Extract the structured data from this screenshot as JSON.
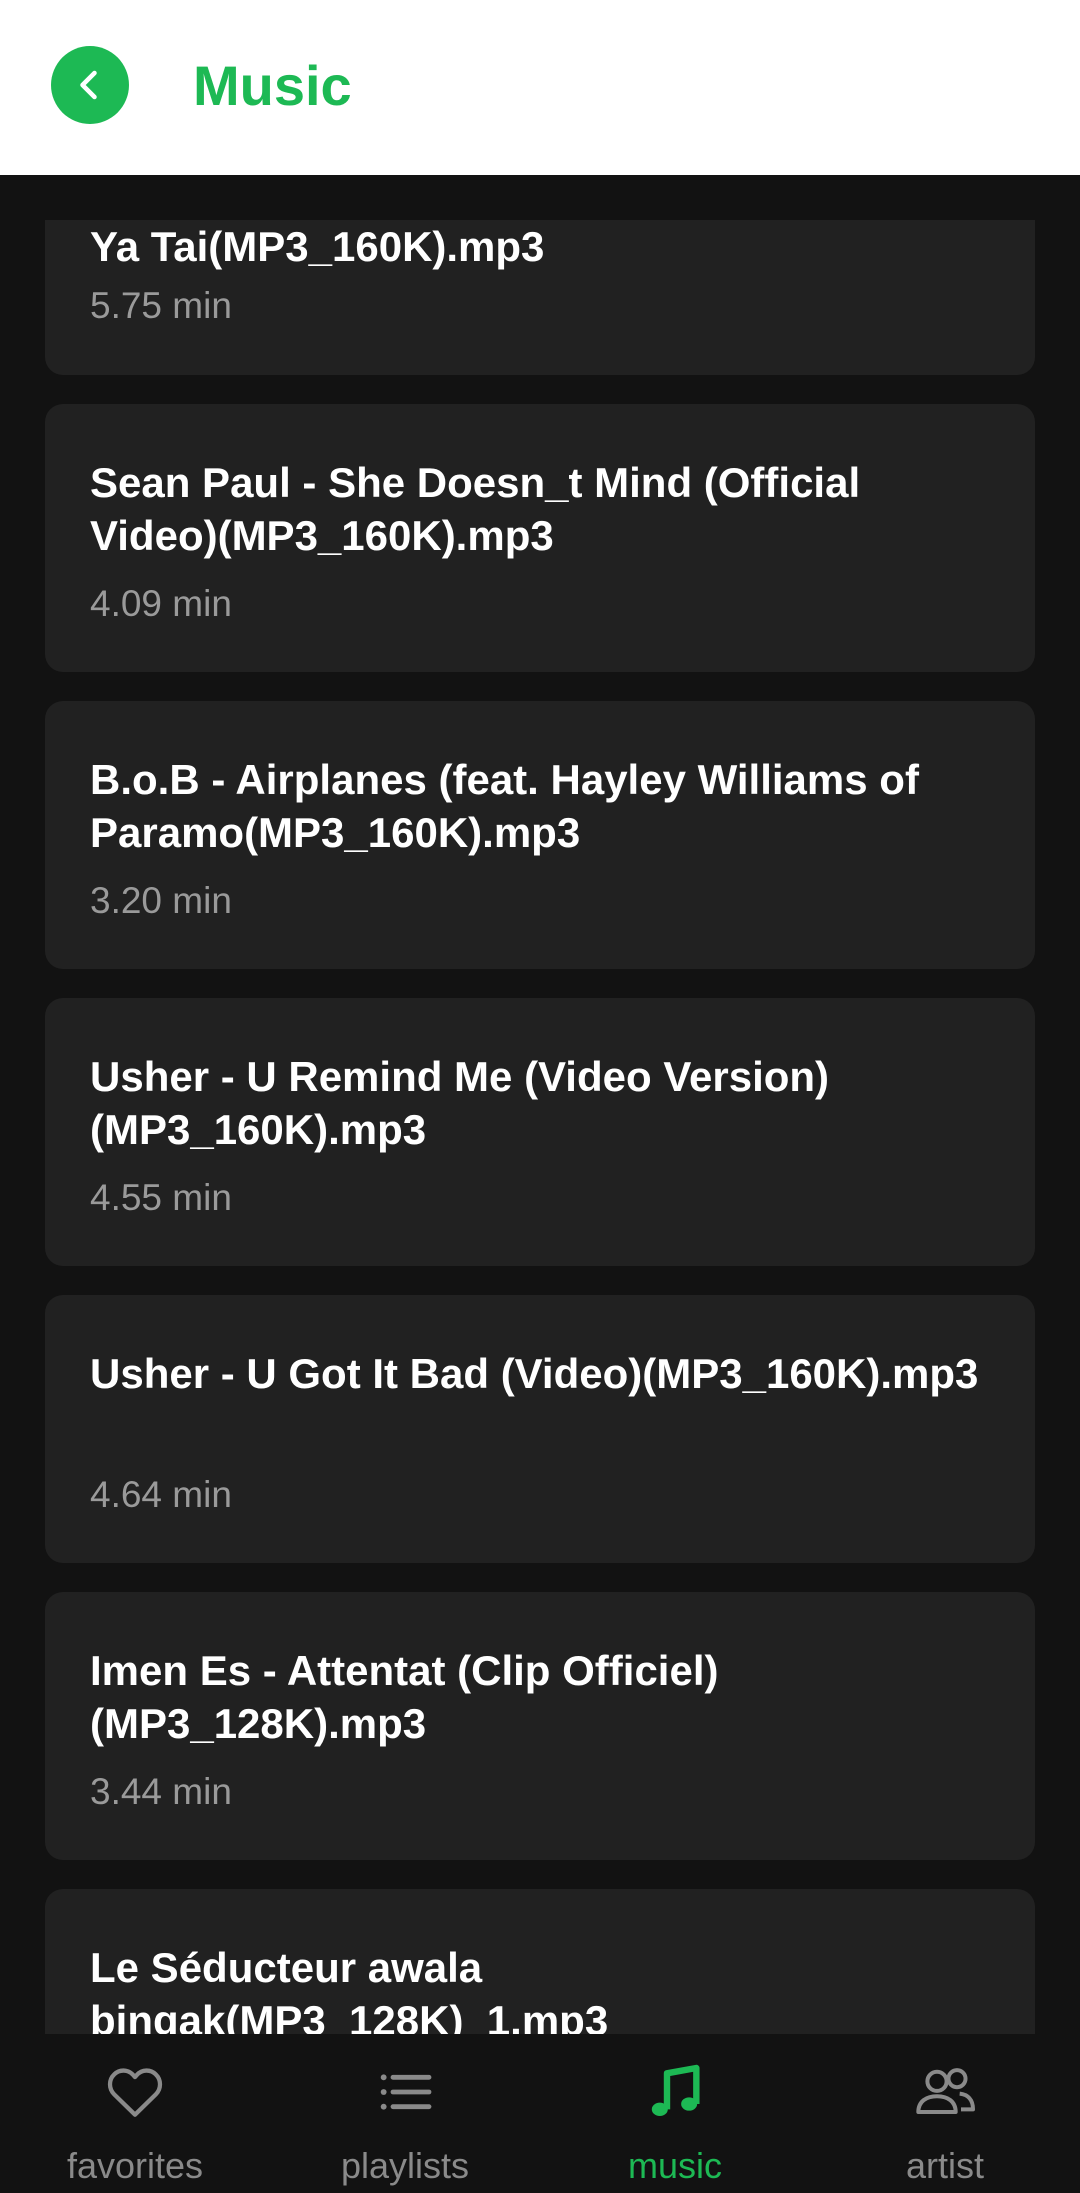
{
  "header": {
    "title": "Music"
  },
  "tracks": [
    {
      "title": "Ya Tai(MP3_160K).mp3",
      "duration": "5.75 min"
    },
    {
      "title": "Sean Paul - She Doesn_t Mind (Official Video)(MP3_160K).mp3",
      "duration": "4.09 min"
    },
    {
      "title": "B.o.B - Airplanes (feat. Hayley Williams of Paramo(MP3_160K).mp3",
      "duration": "3.20 min"
    },
    {
      "title": "Usher - U Remind Me (Video Version)(MP3_160K).mp3",
      "duration": "4.55 min"
    },
    {
      "title": "Usher - U Got It Bad (Video)(MP3_160K).mp3",
      "duration": "4.64 min"
    },
    {
      "title": "Imen Es -  Attentat (Clip Officiel)(MP3_128K).mp3",
      "duration": "3.44 min"
    },
    {
      "title": "Le Séducteur  awala bingak(MP3_128K)_1.mp3",
      "duration": ""
    }
  ],
  "nav": {
    "items": [
      {
        "label": "favorites",
        "icon": "heart-icon"
      },
      {
        "label": "playlists",
        "icon": "list-icon"
      },
      {
        "label": "music",
        "icon": "music-note-icon"
      },
      {
        "label": "artist",
        "icon": "users-icon"
      }
    ],
    "active": "music"
  },
  "colors": {
    "accent": "#1db954",
    "background": "#121212",
    "card": "#212121"
  }
}
